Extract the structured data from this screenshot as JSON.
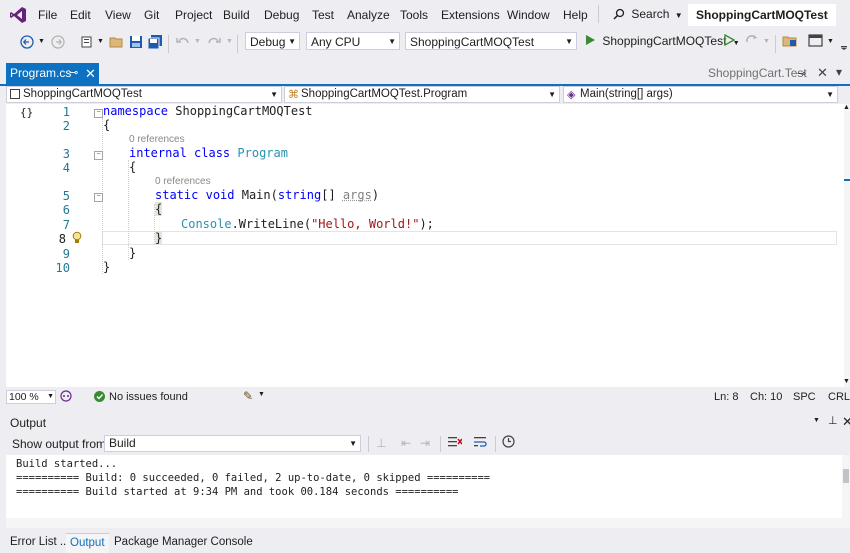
{
  "menubar": {
    "items": [
      "File",
      "Edit",
      "View",
      "Git",
      "Project",
      "Build",
      "Debug",
      "Test",
      "Analyze",
      "Tools",
      "Extensions",
      "Window",
      "Help"
    ],
    "search_label": "Search",
    "solution_name": "ShoppingCartMOQTest"
  },
  "toolbar": {
    "config": "Debug",
    "platform": "Any CPU",
    "startup_project": "ShoppingCartMOQTest",
    "run_label": "ShoppingCartMOQTest"
  },
  "tabs": {
    "active": "Program.cs",
    "preview": "ShoppingCart.Test"
  },
  "navbar": {
    "project": "ShoppingCartMOQTest",
    "type": "ShoppingCartMOQTest.Program",
    "member": "Main(string[] args)"
  },
  "editor": {
    "line_numbers": [
      "1",
      "2",
      "3",
      "4",
      "5",
      "6",
      "7",
      "8",
      "9",
      "10"
    ],
    "refs": [
      "0 references",
      "0 references"
    ],
    "code": {
      "l1_kw": "namespace",
      "l1_name": "ShoppingCartMOQTest",
      "l2": "{",
      "l3_kw1": "internal",
      "l3_kw2": "class",
      "l3_cls": "Program",
      "l4": "{",
      "l5_kw1": "static",
      "l5_kw2": "void",
      "l5_name": "Main(",
      "l5_kw3": "string",
      "l5_br": "[]",
      "l5_param": "args",
      "l5_close": ")",
      "l6": "{",
      "l7_cls": "Console",
      "l7_dot": ".WriteLine(",
      "l7_str": "\"Hello, World!\"",
      "l7_end": ");",
      "l8": "}",
      "l9": "}",
      "l10": "}"
    }
  },
  "status": {
    "zoom": "100 %",
    "issues": "No issues found",
    "ln": "Ln: 8",
    "ch": "Ch: 10",
    "spc": "SPC",
    "crlf": "CRLF"
  },
  "output": {
    "title": "Output",
    "show_from_label": "Show output from:",
    "source": "Build",
    "lines": [
      "Build started...",
      "========== Build: 0 succeeded, 0 failed, 2 up-to-date, 0 skipped ==========",
      "========== Build started at 9:34 PM and took 00.184 seconds =========="
    ]
  },
  "bottom_tabs": [
    "Error List ...",
    "Output",
    "Package Manager Console"
  ],
  "colors": {
    "accent": "#0e70c0",
    "keyword": "#0000ff",
    "type": "#2b91af",
    "string": "#a31515"
  }
}
